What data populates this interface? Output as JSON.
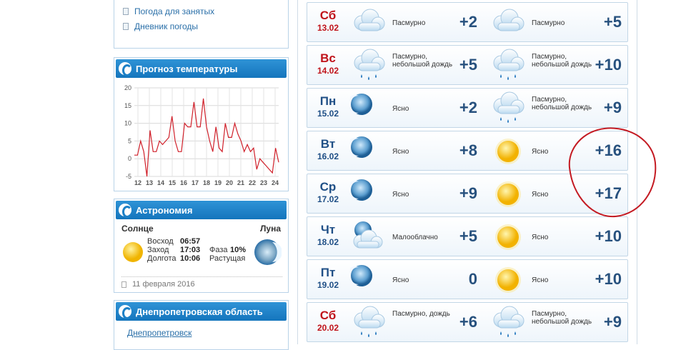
{
  "sidebar": {
    "links": [
      "Погода для занятых",
      "Дневник погоды"
    ],
    "chart_title": "Прогноз температуры",
    "astro": {
      "title": "Астрономия",
      "sun_label": "Солнце",
      "moon_label": "Луна",
      "sunrise_label": "Восход",
      "sunrise": "06:57",
      "sunset_label": "Заход",
      "sunset": "17:03",
      "daylength_label": "Долгота",
      "daylength": "10:06",
      "phase_label": "Фаза",
      "phase": "10%",
      "phase_state": "Растущая",
      "date": "11 февраля 2016"
    },
    "region_title": "Днепропетровская область",
    "region_link": "Днепропетровск"
  },
  "chart_data": {
    "type": "line",
    "title": "Прогноз температуры",
    "x_ticks": [
      "12",
      "13",
      "14",
      "15",
      "16",
      "17",
      "18",
      "19",
      "20",
      "21",
      "22",
      "23",
      "24"
    ],
    "y_ticks": [
      20,
      15,
      10,
      5,
      0,
      -5
    ],
    "ylim": [
      -5,
      20
    ],
    "grid": true,
    "series": [
      {
        "color": "#d0202a",
        "values": [
          1,
          1,
          5,
          2,
          -5,
          8,
          2,
          2,
          5,
          4,
          5,
          6,
          12,
          5,
          2,
          2,
          10,
          9,
          9,
          16,
          9,
          9,
          17,
          9,
          5,
          2,
          9,
          3,
          2,
          10,
          6,
          6,
          10,
          7,
          5,
          2,
          4,
          2,
          3,
          -3,
          0,
          -1,
          -2,
          -3,
          -4,
          3,
          -1
        ]
      }
    ]
  },
  "forecast": [
    {
      "day": "Сб",
      "date": "13.02",
      "weekend": true,
      "icon1": "cloud-icon",
      "cond1": "Пасмурно",
      "t1": "+2",
      "icon2": "cloud-icon",
      "cond2": "Пасмурно",
      "t2": "+5"
    },
    {
      "day": "Вс",
      "date": "14.02",
      "weekend": true,
      "icon1": "cloud-rain-icon",
      "cond1": "Пасмурно, небольшой дождь",
      "t1": "+5",
      "icon2": "cloud-rain-icon",
      "cond2": "Пасмурно, небольшой дождь",
      "t2": "+10"
    },
    {
      "day": "Пн",
      "date": "15.02",
      "weekend": false,
      "icon1": "moon-icon",
      "cond1": "Ясно",
      "t1": "+2",
      "icon2": "cloud-rain-icon",
      "cond2": "Пасмурно, небольшой дождь",
      "t2": "+9"
    },
    {
      "day": "Вт",
      "date": "16.02",
      "weekend": false,
      "icon1": "moon-icon",
      "cond1": "Ясно",
      "t1": "+8",
      "icon2": "sun-icon",
      "cond2": "Ясно",
      "t2": "+16"
    },
    {
      "day": "Ср",
      "date": "17.02",
      "weekend": false,
      "icon1": "moon-icon",
      "cond1": "Ясно",
      "t1": "+9",
      "icon2": "sun-icon",
      "cond2": "Ясно",
      "t2": "+17"
    },
    {
      "day": "Чт",
      "date": "18.02",
      "weekend": false,
      "icon1": "moon-cloud-icon",
      "cond1": "Малооблачно",
      "t1": "+5",
      "icon2": "sun-icon",
      "cond2": "Ясно",
      "t2": "+10"
    },
    {
      "day": "Пт",
      "date": "19.02",
      "weekend": false,
      "icon1": "moon-icon",
      "cond1": "Ясно",
      "t1": "0",
      "icon2": "sun-icon",
      "cond2": "Ясно",
      "t2": "+10"
    },
    {
      "day": "Сб",
      "date": "20.02",
      "weekend": true,
      "icon1": "cloud-rain-icon",
      "cond1": "Пасмурно, дождь",
      "t1": "+6",
      "icon2": "cloud-rain-icon",
      "cond2": "Пасмурно, небольшой дождь",
      "t2": "+9"
    }
  ],
  "colors": {
    "accent": "#1a7cc4",
    "weekend": "#c0131a",
    "weekday": "#1f4f86",
    "temp": "#27517e",
    "annotation": "#c41a22"
  }
}
